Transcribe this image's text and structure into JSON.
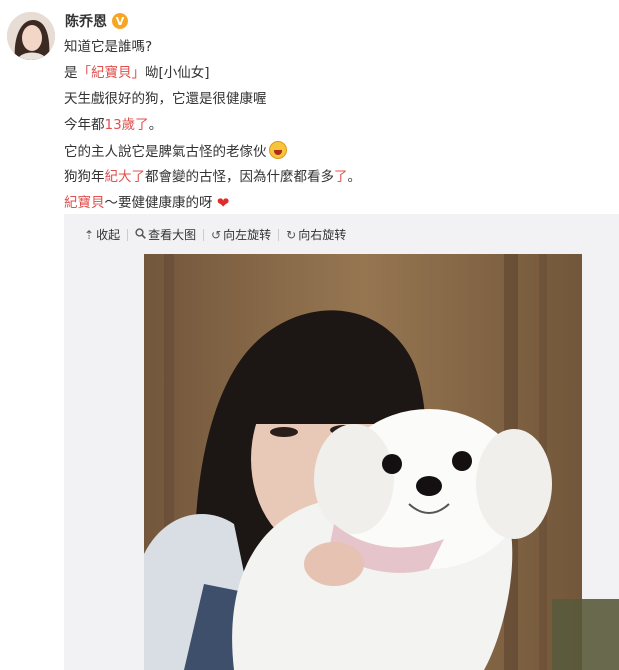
{
  "post": {
    "username": "陈乔恩",
    "verified_badge": "V",
    "lines": [
      {
        "parts": [
          {
            "text": "知道它是誰嗎?",
            "hl": false
          }
        ]
      },
      {
        "parts": [
          {
            "text": "是",
            "hl": false
          },
          {
            "text": "「紀寶貝」",
            "hl": true
          },
          {
            "text": "呦[小仙女]",
            "hl": false
          }
        ]
      },
      {
        "parts": [
          {
            "text": "天生戲很好的狗，它還是很健康喔",
            "hl": false
          }
        ]
      },
      {
        "parts": [
          {
            "text": "今年都",
            "hl": false
          },
          {
            "text": "13歲了",
            "hl": true
          },
          {
            "text": "。",
            "hl": false
          }
        ]
      },
      {
        "parts": [
          {
            "text": "它的主人說它是脾氣古怪的老傢伙",
            "hl": false
          }
        ],
        "emoji": "laugh-emoji"
      },
      {
        "parts": [
          {
            "text": "狗狗年",
            "hl": false
          },
          {
            "text": "紀大了",
            "hl": true
          },
          {
            "text": "都會變的古怪，因為什麼都看多",
            "hl": false
          },
          {
            "text": "了",
            "hl": true
          },
          {
            "text": "。",
            "hl": false
          }
        ]
      },
      {
        "parts": [
          {
            "text": "紀寶貝",
            "hl": true
          },
          {
            "text": "～要健健康康的呀",
            "hl": false
          }
        ],
        "heart": "❤"
      }
    ]
  },
  "toolbar": {
    "collapse": "收起",
    "view_large": "查看大图",
    "rotate_left": "向左旋转",
    "rotate_right": "向右旋转"
  },
  "icons": {
    "collapse": "collapse-arrow-icon",
    "view_large": "magnifier-icon",
    "rotate_left": "rotate-left-icon",
    "rotate_right": "rotate-right-icon"
  },
  "colors": {
    "highlight": "#e0504e",
    "badge": "#f6a623",
    "media_bg": "#f2f2f5"
  }
}
